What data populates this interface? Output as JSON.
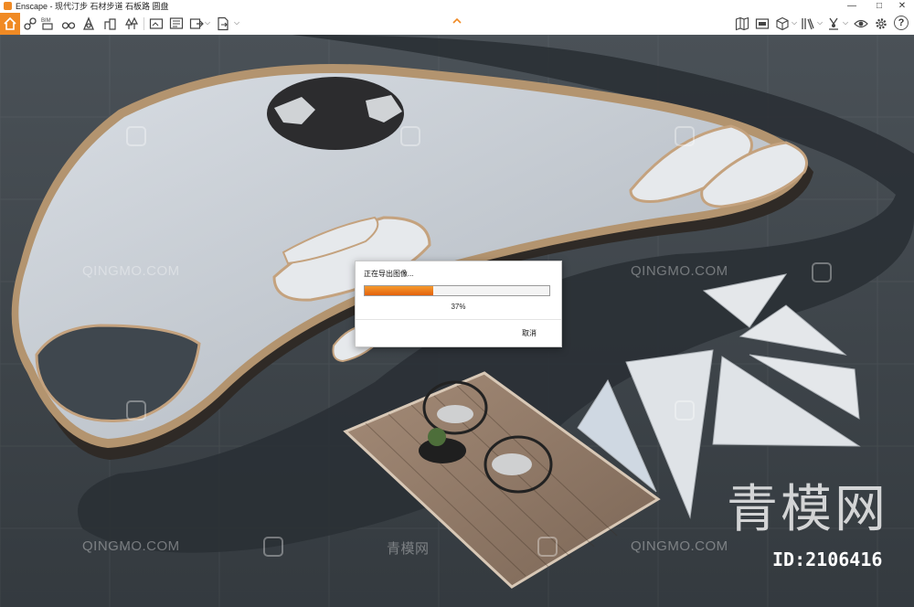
{
  "window": {
    "app_name": "Enscape",
    "title": "Enscape - 现代汀步 石材步道 石板路 圆盘",
    "minimize_symbol": "—",
    "maximize_symbol": "□",
    "close_symbol": "✕"
  },
  "colors": {
    "accent": "#f08a24",
    "progress_start": "#f59b2e",
    "progress_end": "#e4610c"
  },
  "toolbar": {
    "left_icons": [
      "home-icon",
      "link-icon",
      "bim-icon",
      "binoculars-icon",
      "compass-icon",
      "buildings-icon",
      "trees-icon",
      "clapper-icon",
      "screenshot-icon",
      "batch-render-icon",
      "export-icon",
      "export-file-icon"
    ],
    "right_icons": [
      "map-icon",
      "panorama-icon",
      "box-icon",
      "library-icon",
      "capture-icon",
      "visibility-icon",
      "settings-icon",
      "help-icon"
    ],
    "bim_label": "BIM",
    "help_label": "?"
  },
  "dialog": {
    "title": "正在导出图像...",
    "progress_percent": 37,
    "progress_label": "37%",
    "cancel_label": "取消"
  },
  "watermarks": {
    "text": "QINGMO.COM",
    "cn_text": "青模网",
    "brand": "青模网",
    "image_id": "ID:2106416"
  }
}
